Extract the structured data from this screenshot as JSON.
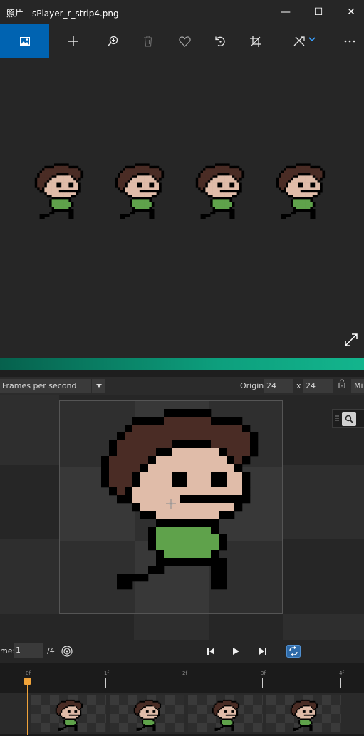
{
  "titlebar": {
    "title": "照片 - sPlayer_r_strip4.png",
    "minimize": "—",
    "maximize": "☐",
    "close": "✕"
  },
  "toolbar": {
    "items": [
      "image-icon",
      "plus-icon",
      "zoom-in-icon",
      "trash-icon",
      "heart-icon",
      "rotate-icon",
      "crop-icon",
      "edit-icon",
      "more-icon"
    ]
  },
  "editor": {
    "playback_mode": "Frames per second",
    "origin_label": "Origin",
    "origin_x": "24",
    "origin_separator": "x",
    "origin_y": "24",
    "mi_label": "Mi"
  },
  "playback": {
    "frame_label": "me:",
    "frame_value": "1",
    "frame_total": "/4"
  },
  "timeline": {
    "ticks": [
      "0f",
      "1f",
      "2f",
      "3f",
      "4f"
    ],
    "current_frame": 0,
    "frame_count": 4
  },
  "colors": {
    "accent": "#0063b1",
    "playhead": "#f0a33a",
    "separator": "#0d9f7d",
    "hair": "#4a2c25",
    "skin": "#e0bca9",
    "shirt": "#5fa24b"
  }
}
